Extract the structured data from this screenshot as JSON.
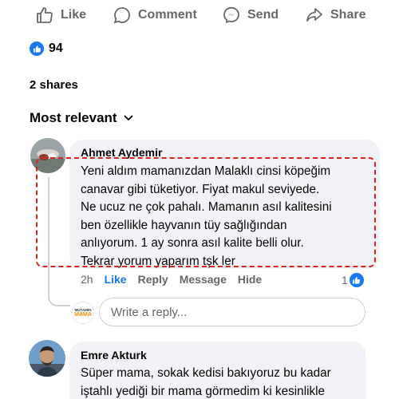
{
  "actions": {
    "like": "Like",
    "comment": "Comment",
    "send": "Send",
    "share": "Share"
  },
  "reactions": {
    "count": "94",
    "icon": "like-badge-icon"
  },
  "shares": "2 shares",
  "sort": {
    "label": "Most relevant"
  },
  "comments": [
    {
      "author": "Ahmet Aydemir",
      "lines": [
        "Yeni aldım mamanızdan Malaklı cinsi köpeğim",
        "canavar gibi tüketiyor. Fiyat makul seviyede.",
        "Ne ucuz ne çok pahalı. Mamanın asıl kalitesini",
        "ben özellikle hayvanın tüy sağlığından",
        "anlıyorum. 1 ay sonra asıl kalite belli olur.",
        "Tekrar yorum yaparım tşk ler"
      ],
      "time": "2h",
      "like_label": "Like",
      "reply_label": "Reply",
      "message_label": "Message",
      "hide_label": "Hide",
      "like_count": "1"
    },
    {
      "author": "Emre Akturk",
      "lines": [
        "Süper mama, sokak kedisi bakıyoruz bu kadar",
        "iştahlı yediği bir mama görmedim ki kesinlikle"
      ]
    }
  ],
  "reply_box": {
    "placeholder": "Write a reply...",
    "page_logo_top": "MUTAMİN",
    "page_logo_bottom": "MAMA"
  },
  "colors": {
    "accent": "#1877f2",
    "muted_text": "#65676b",
    "bubble": "#f0f2f5",
    "highlight": "#e02020"
  }
}
